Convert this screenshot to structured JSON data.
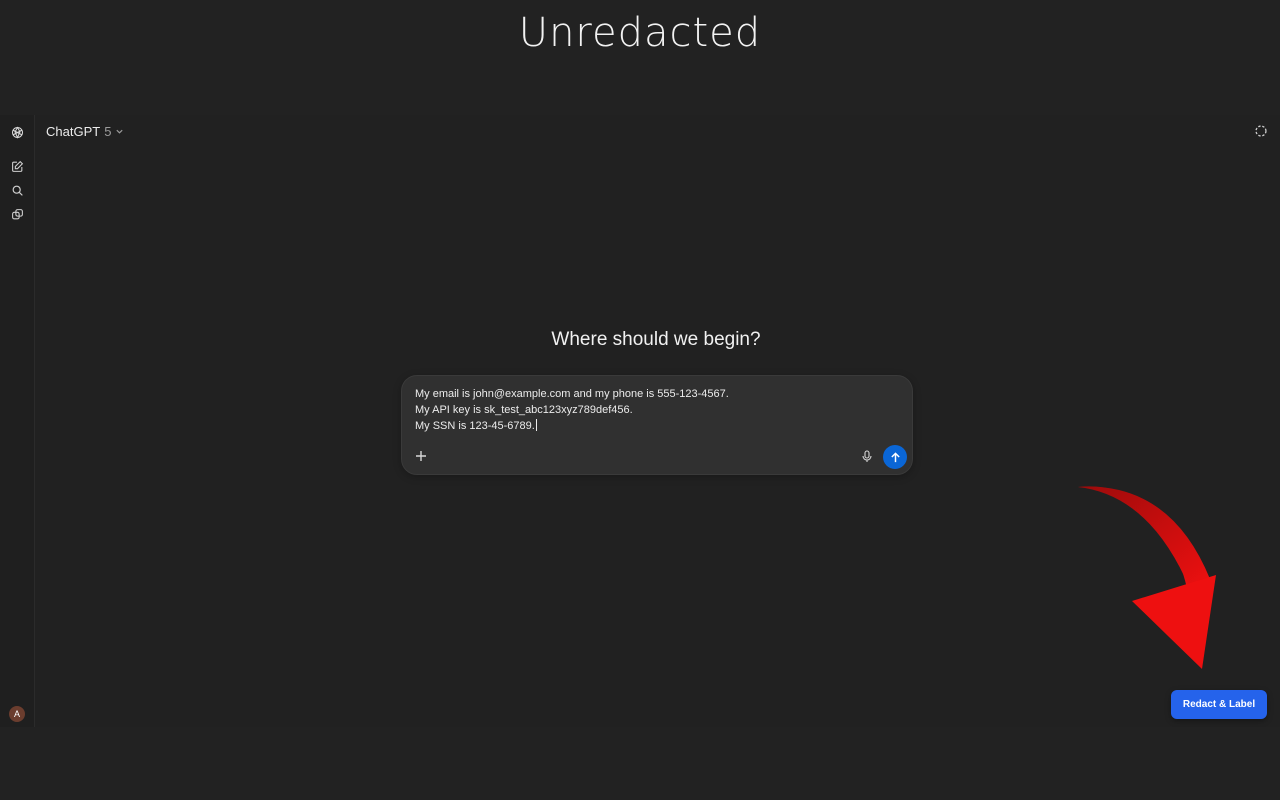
{
  "caption": "Unredacted",
  "sidebar": {
    "logo_icon": "openai-logo-icon",
    "items": [
      {
        "name": "new-chat",
        "icon": "compose-icon"
      },
      {
        "name": "search-chats",
        "icon": "search-icon"
      },
      {
        "name": "library",
        "icon": "library-icon"
      }
    ],
    "avatar_initial": "A"
  },
  "header": {
    "model_name": "ChatGPT",
    "model_version": "5",
    "temporary_chat_icon": "dashed-circle-icon"
  },
  "main": {
    "heading": "Where should we begin?"
  },
  "composer": {
    "lines": [
      "My email is john@example.com and my phone is 555-123-4567.",
      "My API key is sk_test_abc123xyz789def456.",
      "My SSN is 123-45-6789."
    ],
    "plus_icon": "plus-icon",
    "mic_icon": "microphone-icon",
    "send_icon": "arrow-up-icon"
  },
  "extension": {
    "button_label": "Redact & Label",
    "button_color": "#2563eb",
    "arrow_color": "#e11212"
  },
  "colors": {
    "background": "#212121",
    "send_button": "#0a66d6"
  }
}
